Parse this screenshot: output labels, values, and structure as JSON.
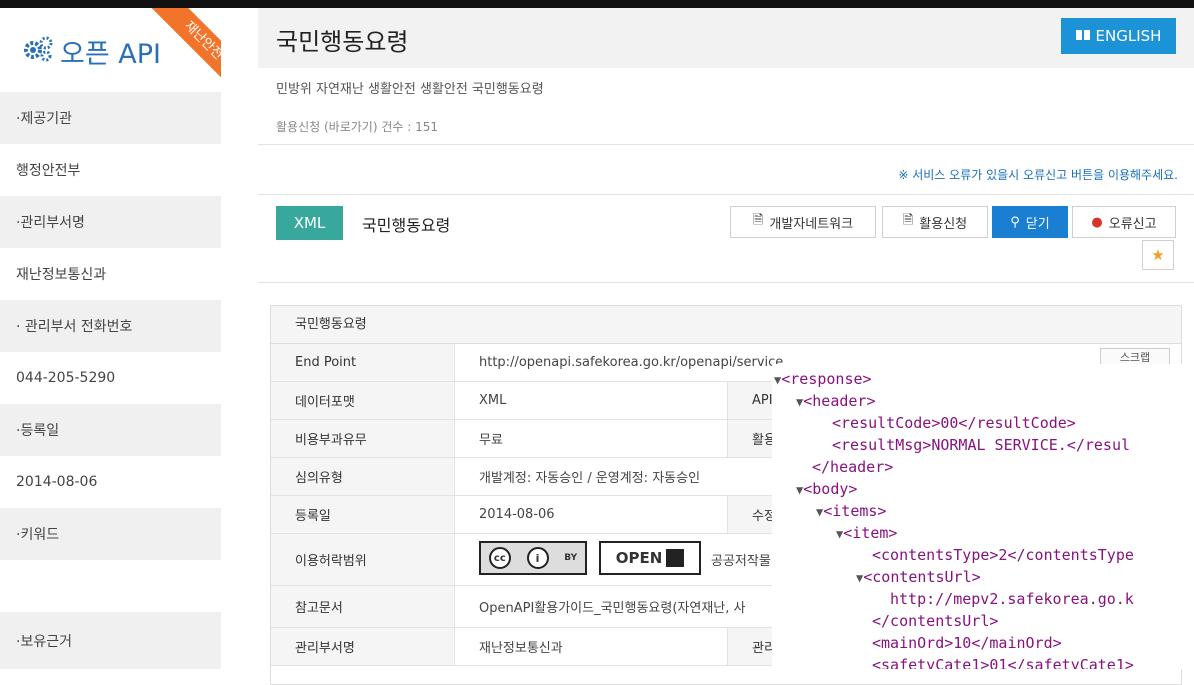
{
  "sidebar": {
    "title": "오픈 API",
    "ribbon": "재난안전",
    "items": [
      {
        "label": "·제공기관",
        "kind": "label"
      },
      {
        "label": "행정안전부",
        "kind": "value"
      },
      {
        "label": "·관리부서명",
        "kind": "label"
      },
      {
        "label": "재난정보통신과",
        "kind": "value"
      },
      {
        "label": "· 관리부서 전화번호",
        "kind": "label"
      },
      {
        "label": "044-205-5290",
        "kind": "value"
      },
      {
        "label": "·등록일",
        "kind": "label"
      },
      {
        "label": "2014-08-06",
        "kind": "value"
      },
      {
        "label": "·키워드",
        "kind": "label"
      },
      {
        "label": "",
        "kind": "value"
      },
      {
        "label": "·보유근거",
        "kind": "label"
      }
    ]
  },
  "header": {
    "title": "국민행동요령",
    "english_button": "ENGLISH",
    "description": "민방위 자연재난 생활안전 생활안전 국민행동요령",
    "usage_count": "활용신청 (바로가기) 건수 : 151"
  },
  "notice": "※ 서비스 오류가 있을시 오류신고 버튼을 이용해주세요.",
  "api": {
    "format_badge": "XML",
    "name": "국민행동요령",
    "buttons": {
      "dev_network": "개발자네트워크",
      "apply": "활용신청",
      "close": "닫기",
      "report": "오류신고"
    }
  },
  "panel": {
    "title": "국민행동요령",
    "copy_button": "스크랩",
    "rows": [
      {
        "label": "End Point",
        "value": "http://openapi.safekorea.go.kr/openapi/service",
        "label2": ""
      },
      {
        "label": "데이터포맷",
        "value": "XML",
        "label2": "API"
      },
      {
        "label": "비용부과유무",
        "value": "무료",
        "label2": "활용"
      },
      {
        "label": "심의유형",
        "value": "개발계정: 자동승인 / 운영계정: 자동승인",
        "label2": ""
      },
      {
        "label": "등록일",
        "value": "2014-08-06",
        "label2": "수정"
      },
      {
        "label": "이용허락범위",
        "value": "공공저작물",
        "label2": ""
      },
      {
        "label": "참고문서",
        "value": "OpenAPI활용가이드_국민행동요령(자연재난, 사",
        "label2": ""
      },
      {
        "label": "관리부서명",
        "value": "재난정보통신과",
        "label2": "관리"
      }
    ],
    "license": {
      "cc": "BY",
      "open": "OPEN"
    }
  },
  "xml_lines": [
    "<response>",
    "<header>",
    "<resultCode>00</resultCode>",
    "<resultMsg>NORMAL SERVICE.</resul",
    "</header>",
    "<body>",
    "<items>",
    "<item>",
    "<contentsType>2</contentsType",
    "<contentsUrl>",
    "http://mepv2.safekorea.go.k",
    "</contentsUrl>",
    "<mainOrd>10</mainOrd>",
    "<safetyCate1>01</safetyCate1>"
  ]
}
